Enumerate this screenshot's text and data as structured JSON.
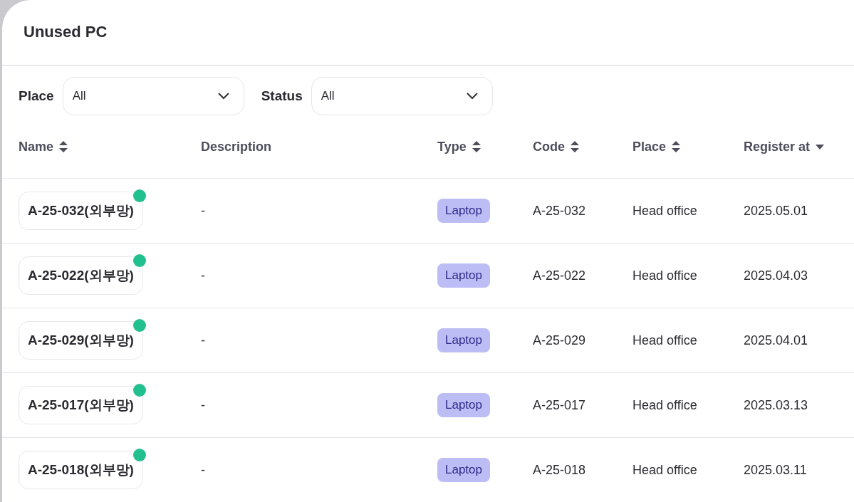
{
  "title": "Unused PC",
  "filters": [
    {
      "label": "Place",
      "value": "All"
    },
    {
      "label": "Status",
      "value": "All"
    }
  ],
  "table": {
    "columns": [
      {
        "label": "Name",
        "kind": "sortable"
      },
      {
        "label": "Description",
        "kind": "plain"
      },
      {
        "label": "Type",
        "kind": "sortable"
      },
      {
        "label": "Code",
        "kind": "sortable"
      },
      {
        "label": "Place",
        "kind": "sortable"
      },
      {
        "label": "Register at",
        "kind": "descending"
      }
    ],
    "rows": [
      {
        "name": "A-25-032(외부망)",
        "color": "#22c08f",
        "description": "-",
        "type": "Laptop",
        "code": "A-25-032",
        "place": "Head office",
        "registered": "2025.05.01"
      },
      {
        "name": "A-25-022(외부망)",
        "color": "#22c08f",
        "description": "-",
        "type": "Laptop",
        "code": "A-25-022",
        "place": "Head office",
        "registered": "2025.04.03"
      },
      {
        "name": "A-25-029(외부망)",
        "color": "#22c08f",
        "description": "-",
        "type": "Laptop",
        "code": "A-25-029",
        "place": "Head office",
        "registered": "2025.04.01"
      },
      {
        "name": "A-25-017(외부망)",
        "color": "#22c08f",
        "description": "-",
        "type": "Laptop",
        "code": "A-25-017",
        "place": "Head office",
        "registered": "2025.03.13"
      },
      {
        "name": "A-25-018(외부망)",
        "color": "#22c08f",
        "description": "-",
        "type": "Laptop",
        "code": "A-25-018",
        "place": "Head office",
        "registered": "2025.03.11"
      }
    ]
  }
}
